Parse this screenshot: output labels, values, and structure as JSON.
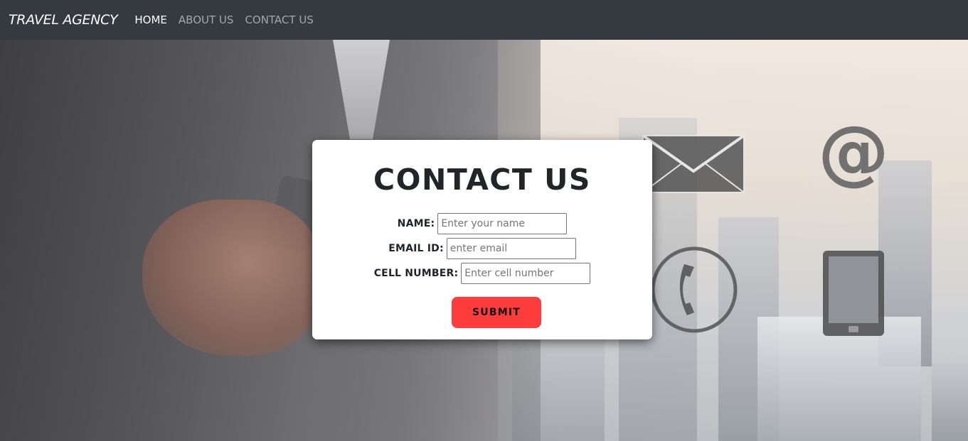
{
  "navbar": {
    "brand": "TRAVEL AGENCY",
    "links": [
      {
        "label": "HOME",
        "active": true
      },
      {
        "label": "ABOUT US",
        "active": false
      },
      {
        "label": "CONTACT US",
        "active": false
      }
    ]
  },
  "contact_form": {
    "title": "CONTACT US",
    "fields": [
      {
        "label": "NAME:",
        "placeholder": "Enter your name",
        "value": ""
      },
      {
        "label": "EMAIL ID:",
        "placeholder": "enter email",
        "value": ""
      },
      {
        "label": "CELL NUMBER:",
        "placeholder": "Enter cell number",
        "value": ""
      }
    ],
    "submit_label": "SUBMIT"
  },
  "background_icons": {
    "at_symbol": "@",
    "icons": [
      "envelope-icon",
      "at-icon",
      "phone-handset-icon",
      "tablet-icon"
    ]
  },
  "colors": {
    "navbar_bg": "#343a40",
    "submit_bg": "#fe3c3c",
    "card_bg": "#ffffff"
  }
}
